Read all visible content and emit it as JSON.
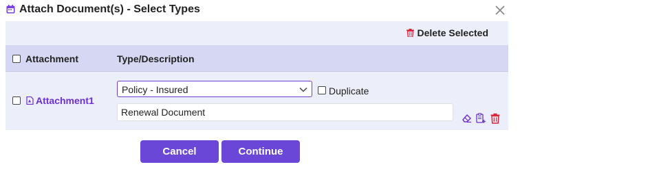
{
  "dialog": {
    "title": "Attach Document(s) - Select Types",
    "delete_selected_label": "Delete Selected"
  },
  "table": {
    "columns": [
      "Attachment",
      "Type/Description"
    ],
    "rows": [
      {
        "attachment_name": "Attachment1",
        "type_selected": "Policy - Insured",
        "duplicate_label": "Duplicate",
        "description": "Renewal Document"
      }
    ]
  },
  "footer": {
    "cancel_label": "Cancel",
    "continue_label": "Continue"
  },
  "colors": {
    "accent": "#6b47d8",
    "link": "#6a2fd6",
    "danger": "#d9243b",
    "panel": "#eceefa",
    "header": "#d6d8f3"
  }
}
